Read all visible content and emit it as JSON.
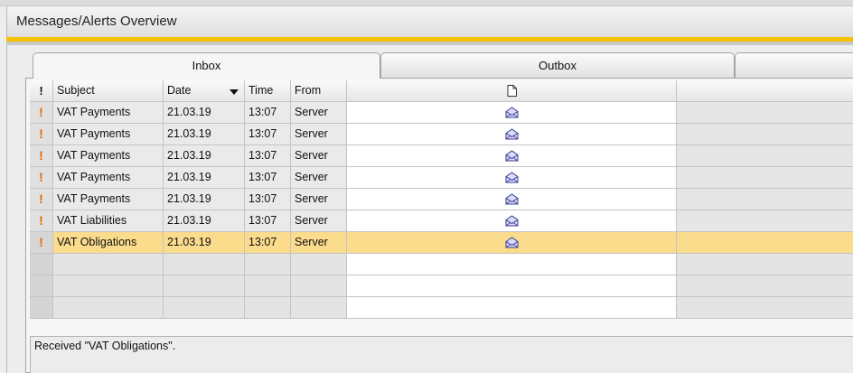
{
  "window": {
    "title": "Messages/Alerts Overview"
  },
  "tabs": [
    {
      "label": "Inbox",
      "active": true
    },
    {
      "label": "Outbox",
      "active": false
    },
    {
      "label": "",
      "active": false
    }
  ],
  "table": {
    "headers": {
      "priority": "!",
      "subject": "Subject",
      "date": "Date",
      "time": "Time",
      "from": "From",
      "attachment_icon": "document-icon"
    },
    "sort": {
      "column": "Date",
      "direction": "descending"
    },
    "rows": [
      {
        "priority": "!",
        "subject": "VAT Payments",
        "date": "21.03.19",
        "time": "13:07",
        "from": "Server",
        "icon": "envelope-open-icon"
      },
      {
        "priority": "!",
        "subject": "VAT Payments",
        "date": "21.03.19",
        "time": "13:07",
        "from": "Server",
        "icon": "envelope-open-icon"
      },
      {
        "priority": "!",
        "subject": "VAT Payments",
        "date": "21.03.19",
        "time": "13:07",
        "from": "Server",
        "icon": "envelope-open-icon"
      },
      {
        "priority": "!",
        "subject": "VAT Payments",
        "date": "21.03.19",
        "time": "13:07",
        "from": "Server",
        "icon": "envelope-open-icon"
      },
      {
        "priority": "!",
        "subject": "VAT Payments",
        "date": "21.03.19",
        "time": "13:07",
        "from": "Server",
        "icon": "envelope-open-icon"
      },
      {
        "priority": "!",
        "subject": "VAT Liabilities",
        "date": "21.03.19",
        "time": "13:07",
        "from": "Server",
        "icon": "envelope-open-icon"
      },
      {
        "priority": "!",
        "subject": "VAT Obligations",
        "date": "21.03.19",
        "time": "13:07",
        "from": "Server",
        "icon": "envelope-open-icon",
        "selected": true
      }
    ]
  },
  "message_preview": {
    "text": "Received \"VAT Obligations\"."
  },
  "colors": {
    "accent": "#f5c000",
    "selected_row": "#fbdc8c",
    "priority": "#e36a00"
  }
}
